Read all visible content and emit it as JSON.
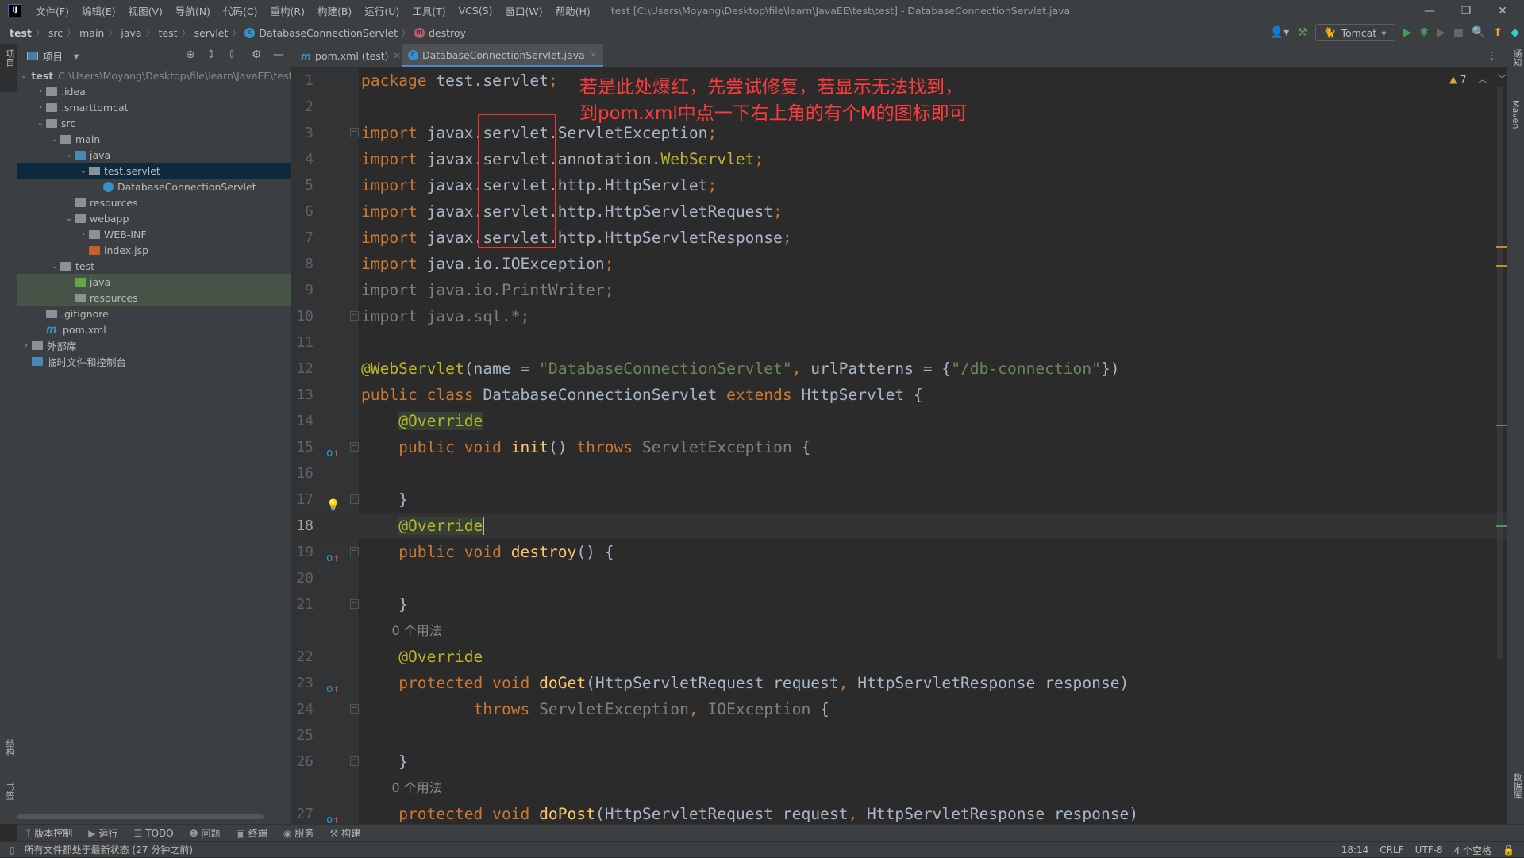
{
  "titlebar": {
    "logo": "IJ",
    "menus": [
      "文件(F)",
      "编辑(E)",
      "视图(V)",
      "导航(N)",
      "代码(C)",
      "重构(R)",
      "构建(B)",
      "运行(U)",
      "工具(T)",
      "VCS(S)",
      "窗口(W)",
      "帮助(H)"
    ],
    "title": "test [C:\\Users\\Moyang\\Desktop\\file\\learn\\JavaEE\\test\\test] - DatabaseConnectionServlet.java"
  },
  "breadcrumb": [
    "test",
    "src",
    "main",
    "java",
    "test",
    "servlet",
    "DatabaseConnectionServlet",
    "destroy"
  ],
  "toolbar": {
    "run_config": "Tomcat"
  },
  "left_strip": {
    "top": "项目",
    "structure": "结构",
    "bookmarks": "书签"
  },
  "right_strip": {
    "notifications": "通知",
    "maven": "Maven",
    "database": "数据库"
  },
  "project": {
    "header": "项目",
    "root_path": "C:\\Users\\Moyang\\Desktop\\file\\learn\\JavaEE\\test",
    "tree": [
      {
        "label": "test",
        "level": 0,
        "arrow": "open",
        "icon": "module",
        "bold": true
      },
      {
        "label": ".idea",
        "level": 1,
        "arrow": "closed",
        "icon": "folder"
      },
      {
        "label": ".smarttomcat",
        "level": 1,
        "arrow": "closed",
        "icon": "folder"
      },
      {
        "label": "src",
        "level": 1,
        "arrow": "open",
        "icon": "folder"
      },
      {
        "label": "main",
        "level": 2,
        "arrow": "open",
        "icon": "folder"
      },
      {
        "label": "java",
        "level": 3,
        "arrow": "open",
        "icon": "source-folder"
      },
      {
        "label": "test.servlet",
        "level": 4,
        "arrow": "open",
        "icon": "package",
        "selected": true
      },
      {
        "label": "DatabaseConnectionServlet",
        "level": 5,
        "icon": "class"
      },
      {
        "label": "resources",
        "level": 3,
        "icon": "resources-folder"
      },
      {
        "label": "webapp",
        "level": 3,
        "arrow": "open",
        "icon": "folder"
      },
      {
        "label": "WEB-INF",
        "level": 4,
        "arrow": "closed",
        "icon": "folder"
      },
      {
        "label": "index.jsp",
        "level": 4,
        "icon": "jsp"
      },
      {
        "label": "test",
        "level": 2,
        "arrow": "open",
        "icon": "folder"
      },
      {
        "label": "java",
        "level": 3,
        "icon": "test-folder",
        "highlight": true
      },
      {
        "label": "resources",
        "level": 3,
        "icon": "test-resources-folder",
        "highlight": true
      },
      {
        "label": ".gitignore",
        "level": 1,
        "icon": "ignore-file"
      },
      {
        "label": "pom.xml",
        "level": 1,
        "icon": "maven"
      },
      {
        "label": "外部库",
        "level": 0,
        "arrow": "closed",
        "icon": "library"
      },
      {
        "label": "临时文件和控制台",
        "level": 0,
        "icon": "scratch"
      }
    ]
  },
  "tabs": [
    {
      "label": "pom.xml (test)",
      "icon": "maven",
      "active": false
    },
    {
      "label": "DatabaseConnectionServlet.java",
      "icon": "class",
      "active": true
    }
  ],
  "editor": {
    "warnings": "7",
    "caret_line": "18",
    "note": [
      "若是此处爆红，先尝试修复，若显示无法找到，",
      "到pom.xml中点一下右上角的有个M的图标即可"
    ],
    "rows": [
      {
        "n": "1",
        "t": [
          [
            "kw",
            "package"
          ],
          [
            "id",
            " test.servlet"
          ],
          [
            "kw",
            ";"
          ]
        ]
      },
      {
        "n": "2",
        "t": []
      },
      {
        "n": "3",
        "fold": true,
        "t": [
          [
            "kw",
            "import"
          ],
          [
            "id",
            " javax.servlet.ServletException"
          ],
          [
            "kw",
            ";"
          ]
        ]
      },
      {
        "n": "4",
        "t": [
          [
            "kw",
            "import"
          ],
          [
            "id",
            " javax.servlet.annotation."
          ],
          [
            "ann",
            "WebServlet"
          ],
          [
            "kw",
            ";"
          ]
        ]
      },
      {
        "n": "5",
        "t": [
          [
            "kw",
            "import"
          ],
          [
            "id",
            " javax.servlet.http.HttpServlet"
          ],
          [
            "kw",
            ";"
          ]
        ]
      },
      {
        "n": "6",
        "t": [
          [
            "kw",
            "import"
          ],
          [
            "id",
            " javax.servlet.http.HttpServletRequest"
          ],
          [
            "kw",
            ";"
          ]
        ]
      },
      {
        "n": "7",
        "t": [
          [
            "kw",
            "import"
          ],
          [
            "id",
            " javax.servlet.http.HttpServletResponse"
          ],
          [
            "kw",
            ";"
          ]
        ]
      },
      {
        "n": "8",
        "t": [
          [
            "kw",
            "import"
          ],
          [
            "id",
            " java.io.IOException"
          ],
          [
            "kw",
            ";"
          ]
        ]
      },
      {
        "n": "9",
        "t": [
          [
            "gray",
            "import java.io.PrintWriter;"
          ]
        ]
      },
      {
        "n": "10",
        "fold": true,
        "t": [
          [
            "gray",
            "import java.sql.*;"
          ]
        ]
      },
      {
        "n": "11",
        "t": []
      },
      {
        "n": "12",
        "t": [
          [
            "ann",
            "@WebServlet"
          ],
          [
            "id",
            "(name = "
          ],
          [
            "str",
            "\"DatabaseConnectionServlet\""
          ],
          [
            "kw",
            ", "
          ],
          [
            "id",
            "urlPatterns = {"
          ],
          [
            "str",
            "\"/db-connection\""
          ],
          [
            "id",
            "})"
          ]
        ]
      },
      {
        "n": "13",
        "t": [
          [
            "kw",
            "public class "
          ],
          [
            "id",
            "DatabaseConnectionServlet "
          ],
          [
            "kw",
            "extends "
          ],
          [
            "id",
            "HttpServlet {"
          ]
        ]
      },
      {
        "n": "14",
        "t": [
          [
            "id",
            "    "
          ],
          [
            "ann annbg",
            "@Override"
          ]
        ]
      },
      {
        "n": "15",
        "gutter": "override",
        "fold": true,
        "t": [
          [
            "id",
            "    "
          ],
          [
            "kw",
            "public void "
          ],
          [
            "fn",
            "init"
          ],
          [
            "id",
            "() "
          ],
          [
            "kw",
            "throws "
          ],
          [
            "gray",
            "ServletException"
          ],
          [
            "id",
            " {"
          ]
        ]
      },
      {
        "n": "16",
        "t": []
      },
      {
        "n": "17",
        "gutter": "bulb",
        "fold": true,
        "t": [
          [
            "id",
            "    }"
          ]
        ]
      },
      {
        "n": "18",
        "caret": true,
        "t": [
          [
            "id",
            "    "
          ],
          [
            "ann annbg cursor",
            "@Override"
          ]
        ]
      },
      {
        "n": "19",
        "gutter": "override",
        "fold": true,
        "t": [
          [
            "id",
            "    "
          ],
          [
            "kw",
            "public void "
          ],
          [
            "fn",
            "destroy"
          ],
          [
            "id",
            "() {"
          ]
        ]
      },
      {
        "n": "20",
        "t": []
      },
      {
        "n": "21",
        "fold": true,
        "t": [
          [
            "id",
            "    }"
          ]
        ]
      },
      {
        "inlay": "0 个用法"
      },
      {
        "n": "22",
        "t": [
          [
            "id",
            "    "
          ],
          [
            "ann",
            "@Override"
          ]
        ]
      },
      {
        "n": "23",
        "gutter": "override",
        "t": [
          [
            "id",
            "    "
          ],
          [
            "kw",
            "protected void "
          ],
          [
            "fn",
            "doGet"
          ],
          [
            "id",
            "(HttpServletRequest request"
          ],
          [
            "kw",
            ", "
          ],
          [
            "id",
            "HttpServletResponse response)"
          ]
        ]
      },
      {
        "n": "24",
        "fold": true,
        "t": [
          [
            "id",
            "            "
          ],
          [
            "kw",
            "throws "
          ],
          [
            "gray",
            "ServletException"
          ],
          [
            "kw",
            ", "
          ],
          [
            "gray",
            "IOException"
          ],
          [
            "id",
            " {"
          ]
        ]
      },
      {
        "n": "25",
        "t": []
      },
      {
        "n": "26",
        "fold": true,
        "t": [
          [
            "id",
            "    }"
          ]
        ]
      },
      {
        "inlay": "0 个用法"
      },
      {
        "n": "27",
        "gutter": "override",
        "t": [
          [
            "id",
            "    "
          ],
          [
            "kw",
            "protected void "
          ],
          [
            "fn",
            "doPost"
          ],
          [
            "id",
            "(HttpServletRequest request"
          ],
          [
            "kw",
            ", "
          ],
          [
            "id",
            "HttpServletResponse response)"
          ]
        ]
      }
    ]
  },
  "tool_windows": [
    {
      "label": "版本控制",
      "icon": "vcs-icon"
    },
    {
      "label": "运行",
      "icon": "run-icon"
    },
    {
      "label": "TODO",
      "icon": "todo-icon"
    },
    {
      "label": "问题",
      "icon": "problems-icon"
    },
    {
      "label": "终端",
      "icon": "terminal-icon"
    },
    {
      "label": "服务",
      "icon": "services-icon"
    },
    {
      "label": "构建",
      "icon": "build-icon"
    }
  ],
  "status": {
    "message": "所有文件都处于最新状态 (27 分钟之前)",
    "position": "18:14",
    "line_ending": "CRLF",
    "encoding": "UTF-8",
    "indent": "4 个空格"
  },
  "colors": {
    "keyword": "#cc7832",
    "identifier": "#a9b7c6",
    "string": "#6a8759",
    "annotation": "#bbb529",
    "method": "#ffc66d",
    "annotation_red": "#ff3b3b"
  }
}
